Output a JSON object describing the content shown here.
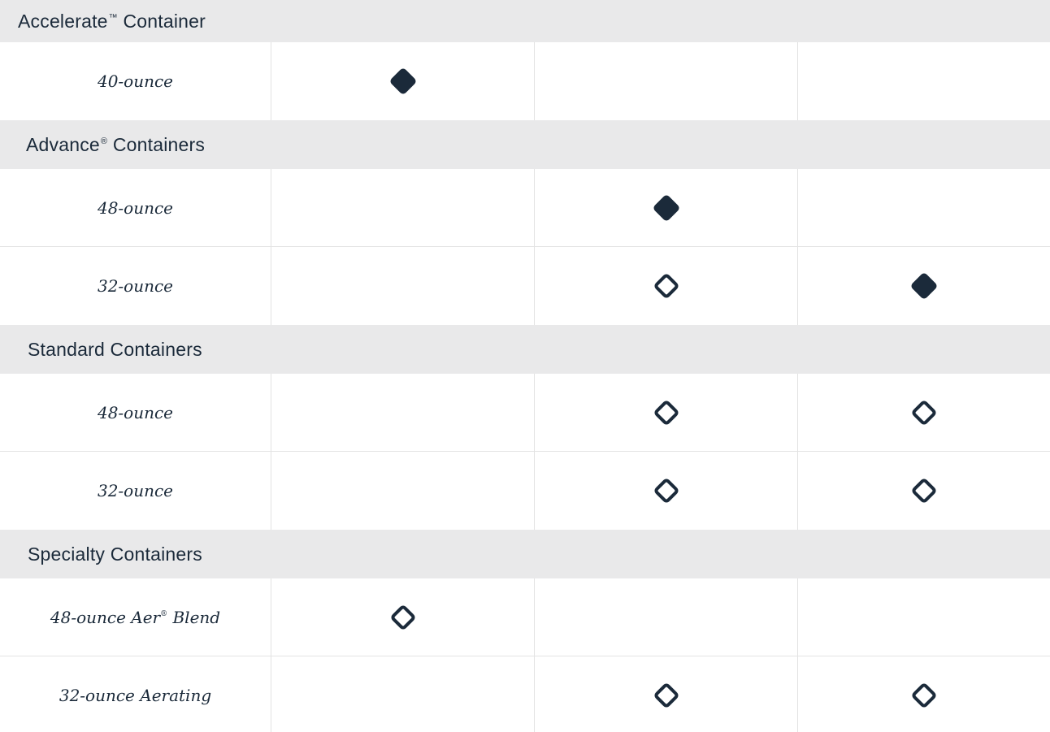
{
  "table": {
    "groups": [
      {
        "title": "Accelerate",
        "title_mark": "™",
        "title_suffix": " Container",
        "rows": [
          {
            "label": "40-ounce",
            "label_mark": "",
            "label_suffix": "",
            "cells": [
              "filled-diamond-icon",
              "",
              ""
            ]
          }
        ]
      },
      {
        "title": "Advance",
        "title_mark": "®",
        "title_suffix": " Containers",
        "rows": [
          {
            "label": "48-ounce",
            "label_mark": "",
            "label_suffix": "",
            "cells": [
              "",
              "filled-diamond-icon",
              ""
            ]
          },
          {
            "label": "32-ounce",
            "label_mark": "",
            "label_suffix": "",
            "cells": [
              "",
              "outline-diamond-icon",
              "filled-diamond-icon"
            ]
          }
        ]
      },
      {
        "title": "Standard Containers",
        "title_mark": "",
        "title_suffix": "",
        "rows": [
          {
            "label": "48-ounce",
            "label_mark": "",
            "label_suffix": "",
            "cells": [
              "",
              "outline-diamond-icon",
              "outline-diamond-icon"
            ]
          },
          {
            "label": "32-ounce",
            "label_mark": "",
            "label_suffix": "",
            "cells": [
              "",
              "outline-diamond-icon",
              "outline-diamond-icon"
            ]
          }
        ]
      },
      {
        "title": "Specialty Containers",
        "title_mark": "",
        "title_suffix": "",
        "rows": [
          {
            "label": "48-ounce Aer",
            "label_mark": "®",
            "label_suffix": " Blend",
            "cells": [
              "outline-diamond-icon",
              "",
              ""
            ]
          },
          {
            "label": "32-ounce Aerating",
            "label_mark": "",
            "label_suffix": "",
            "cells": [
              "",
              "outline-diamond-icon",
              "outline-diamond-icon"
            ]
          }
        ]
      }
    ]
  },
  "colors": {
    "header_bg": "#e9e9ea",
    "ink": "#1b2a3a",
    "divider": "#e3e3e3"
  }
}
